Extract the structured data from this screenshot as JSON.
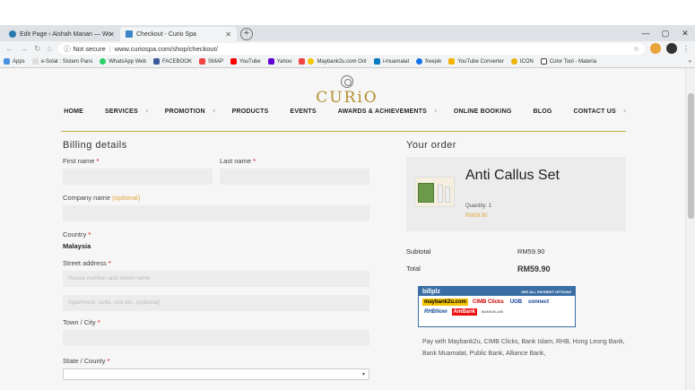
{
  "browser": {
    "tabs": [
      {
        "label": "Edit Page ‹ Aishah Manan — Wo",
        "active": false
      },
      {
        "label": "Checkout - Curio Spa",
        "active": true
      }
    ],
    "new_tab": "+",
    "window_controls": [
      "—",
      "▢",
      "✕"
    ],
    "not_secure": "Not secure",
    "url": "www.curiospa.com/shop/checkout/",
    "bookmarks": [
      "Apps",
      "e-Solat : Sistem Pans",
      "WhatsApp Web",
      "FACEBOOK",
      "SMAP",
      "YouTube",
      "Yahoo",
      "Maybank2u.com Onl",
      "i-muamalat",
      "freepik",
      "YouTube Converter",
      "ICON",
      "Color Tool - Materia"
    ]
  },
  "site": {
    "logo_text": "CURiO",
    "nav": [
      {
        "label": "HOME",
        "dropdown": false
      },
      {
        "label": "SERVICES",
        "dropdown": true
      },
      {
        "label": "PROMOTION",
        "dropdown": true
      },
      {
        "label": "PRODUCTS",
        "dropdown": false
      },
      {
        "label": "EVENTS",
        "dropdown": false
      },
      {
        "label": "AWARDS & ACHIEVEMENTS",
        "dropdown": true
      },
      {
        "label": "ONLINE BOOKING",
        "dropdown": false
      },
      {
        "label": "BLOG",
        "dropdown": false
      },
      {
        "label": "CONTACT US",
        "dropdown": true
      }
    ]
  },
  "billing": {
    "heading": "Billing details",
    "first_name": "First name",
    "last_name": "Last name",
    "required": "*",
    "company": "Company name",
    "optional": "(optional)",
    "country_label": "Country",
    "country_value": "Malaysia",
    "street_label": "Street address",
    "street_ph1": "House number and street name",
    "street_ph2": "Apartment, suite, unit etc. (optional)",
    "town_label": "Town / City",
    "state_label": "State / County"
  },
  "order": {
    "heading": "Your order",
    "product_name": "Anti Callus Set",
    "quantity": "Quantity: 1",
    "price": "RM59.90",
    "subtotal_label": "Subtotal",
    "subtotal_value": "RM59.90",
    "total_label": "Total",
    "total_value": "RM59.90",
    "billplz_brand": "billplz",
    "billplz_tag": "SEE ALL PAYMENT OPTIONS",
    "bank_logos": [
      "maybank2u.com",
      "CIMB Clicks",
      "UOB",
      "connect",
      "RHBNow",
      "AmBank",
      "BANKISLAM"
    ],
    "pay_text": "Pay with Maybank2u, CIMB Clicks, Bank Islam, RHB, Hong Leong Bank, Bank Muamalat, Public Bank, Alliance Bank,"
  },
  "colors": {
    "accent": "#b38f2c",
    "required": "#cc0000",
    "optional": "#e2a53c"
  }
}
